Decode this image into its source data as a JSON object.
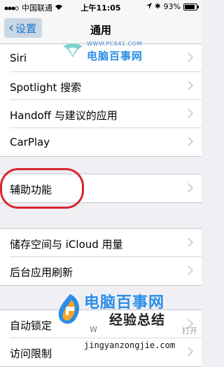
{
  "status_bar": {
    "carrier": "中国联通",
    "time": "上午11:05",
    "battery": "93%"
  },
  "nav": {
    "back_label": "设置",
    "title": "通用"
  },
  "watermark_top": {
    "url": "WWW.PC841.COM",
    "name": "电脑百事网"
  },
  "groups": [
    {
      "items": [
        "Siri",
        "Spotlight 搜索",
        "Handoff 与建议的应用",
        "CarPlay"
      ]
    },
    {
      "items": [
        "辅助功能"
      ]
    },
    {
      "items": [
        "储存空间与 iCloud 用量",
        "后台应用刷新"
      ]
    },
    {
      "items": [
        "自动锁定",
        "访问限制"
      ]
    }
  ],
  "watermark_bottom": {
    "brand": "电脑百事网",
    "sub": "经验总结",
    "url": "jingyanzongjie.com",
    "partial": "W",
    "open": "打开"
  },
  "colors": {
    "accent": "#1e73c8",
    "highlight": "#d8262e"
  }
}
